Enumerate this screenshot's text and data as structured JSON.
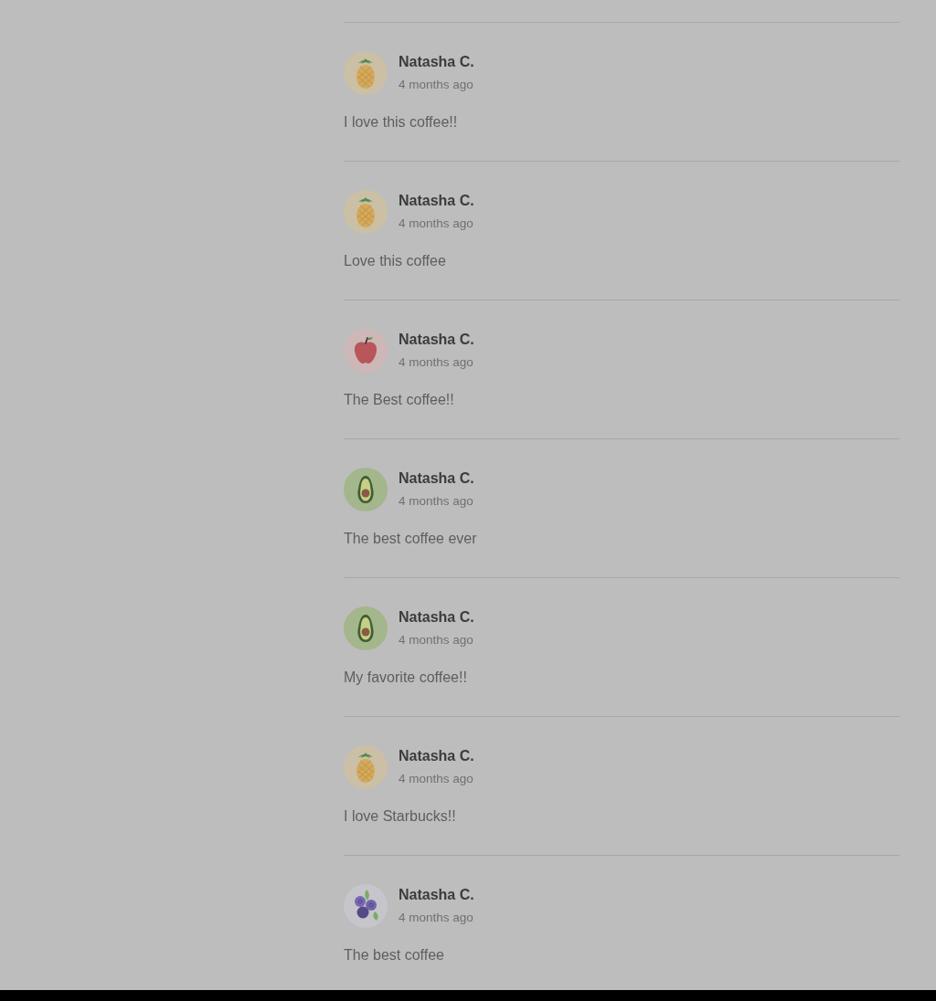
{
  "reviews": [
    {
      "author": "Natasha C.",
      "time": "4 months ago",
      "comment": "I love this coffee!!",
      "avatar": {
        "kind": "pineapple"
      }
    },
    {
      "author": "Natasha C.",
      "time": "4 months ago",
      "comment": "Love this coffee",
      "avatar": {
        "kind": "pineapple"
      }
    },
    {
      "author": "Natasha C.",
      "time": "4 months ago",
      "comment": "The Best coffee!!",
      "avatar": {
        "kind": "apple"
      }
    },
    {
      "author": "Natasha C.",
      "time": "4 months ago",
      "comment": "The best coffee ever",
      "avatar": {
        "kind": "avocado"
      }
    },
    {
      "author": "Natasha C.",
      "time": "4 months ago",
      "comment": "My favorite coffee!!",
      "avatar": {
        "kind": "avocado"
      }
    },
    {
      "author": "Natasha C.",
      "time": "4 months ago",
      "comment": "I love Starbucks!!",
      "avatar": {
        "kind": "pineapple"
      }
    },
    {
      "author": "Natasha C.",
      "time": "4 months ago",
      "comment": "The best coffee",
      "avatar": {
        "kind": "blueberry"
      }
    }
  ]
}
